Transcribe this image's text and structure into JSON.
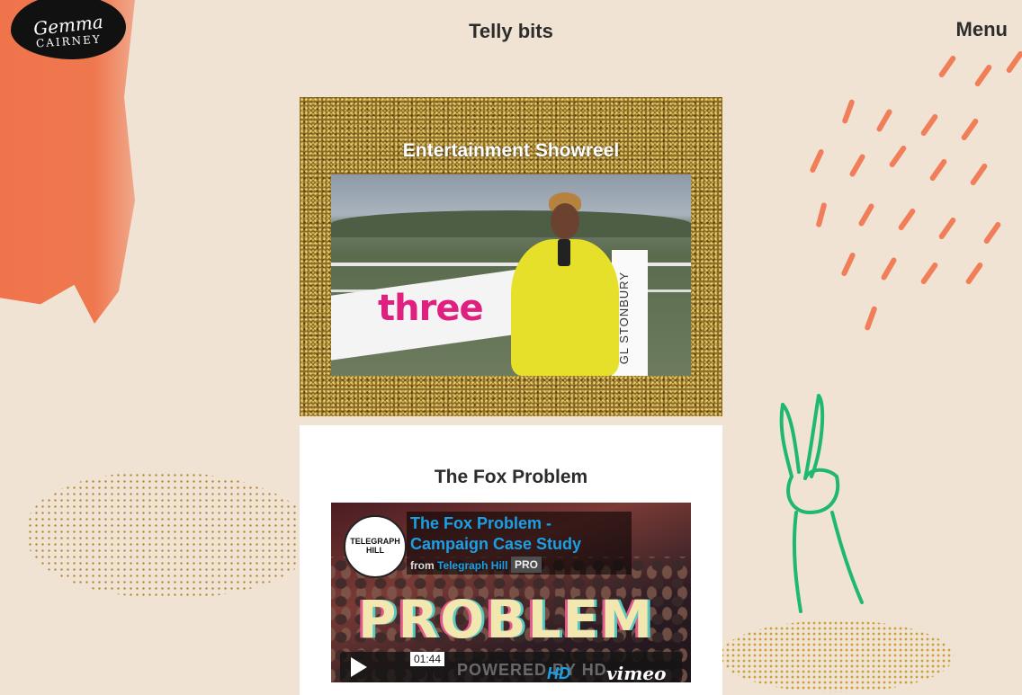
{
  "site": {
    "logo_line1": "Gemma",
    "logo_line2": "CAIRNEY"
  },
  "header": {
    "title": "Telly bits",
    "menu_label": "Menu"
  },
  "sections": [
    {
      "title": "Entertainment Showreel",
      "video": {
        "sign_text": "three",
        "sign_text2": "GL STONBURY"
      }
    },
    {
      "title": "The Fox Problem",
      "video": {
        "channel_logo_text": "TELEGRAPH HILL",
        "video_title": "The Fox Problem - Campaign Case Study",
        "from_label": "from",
        "from_author": "Telegraph Hill",
        "badge": "PRO",
        "overlay_word": "PROBLEM",
        "duration": "01:44",
        "watermark": "POWERED BY HD",
        "hd_label": "HD",
        "provider": "vimeo"
      }
    }
  ],
  "colors": {
    "background": "#f0e3d4",
    "accent_orange": "#f06a3f",
    "accent_green": "#1fb870",
    "vimeo_blue": "#1aa0e6"
  }
}
